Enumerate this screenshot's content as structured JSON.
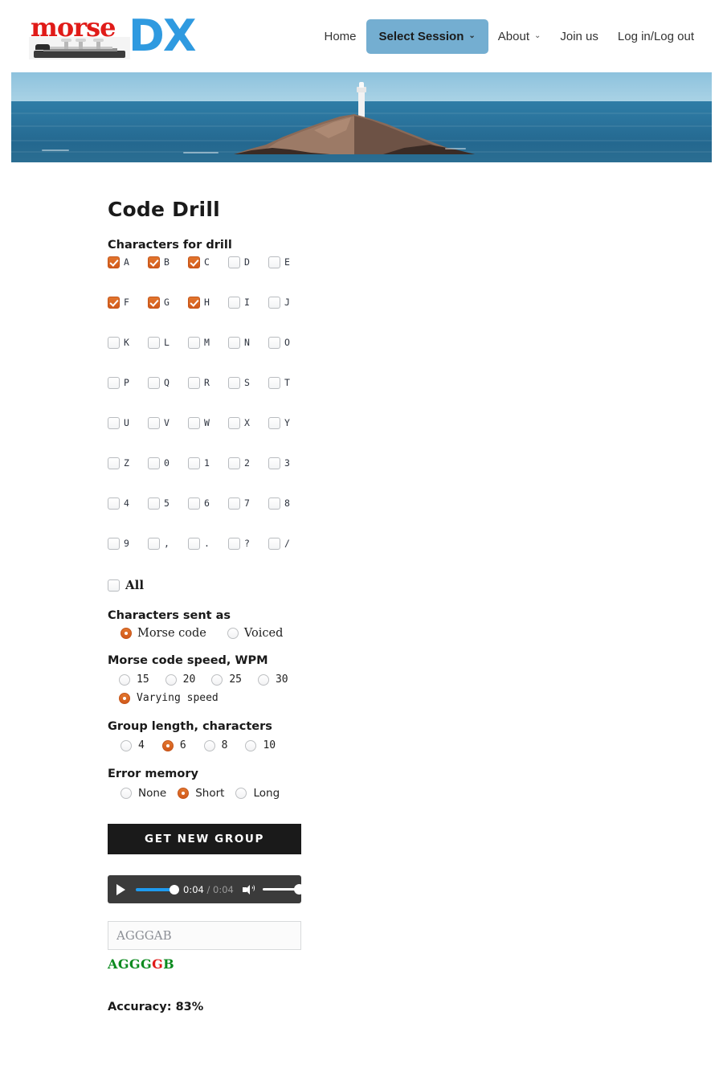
{
  "header": {
    "logo": {
      "text_primary": "morse",
      "text_secondary": "DX",
      "icon": "telegraph-key-icon"
    },
    "nav": [
      {
        "label": "Home",
        "active": false,
        "caret": ""
      },
      {
        "label": "Select Session",
        "active": true,
        "caret": "⌄"
      },
      {
        "label": "About",
        "active": false,
        "caret": "⌄"
      },
      {
        "label": "Join us",
        "active": false,
        "caret": ""
      },
      {
        "label": "Log in/Log out",
        "active": false,
        "caret": ""
      }
    ]
  },
  "hero": {
    "alt": "lighthouse-on-rock-island-photo"
  },
  "main": {
    "title": "Code Drill",
    "characters_label": "Characters for drill",
    "char_rows": [
      [
        {
          "c": "A",
          "on": true
        },
        {
          "c": "B",
          "on": true
        },
        {
          "c": "C",
          "on": true
        },
        {
          "c": "D",
          "on": false
        },
        {
          "c": "E",
          "on": false
        }
      ],
      [
        {
          "c": "F",
          "on": true
        },
        {
          "c": "G",
          "on": true
        },
        {
          "c": "H",
          "on": true
        },
        {
          "c": "I",
          "on": false
        },
        {
          "c": "J",
          "on": false
        }
      ],
      [
        {
          "c": "K",
          "on": false
        },
        {
          "c": "L",
          "on": false
        },
        {
          "c": "M",
          "on": false
        },
        {
          "c": "N",
          "on": false
        },
        {
          "c": "O",
          "on": false
        }
      ],
      [
        {
          "c": "P",
          "on": false
        },
        {
          "c": "Q",
          "on": false
        },
        {
          "c": "R",
          "on": false
        },
        {
          "c": "S",
          "on": false
        },
        {
          "c": "T",
          "on": false
        }
      ],
      [
        {
          "c": "U",
          "on": false
        },
        {
          "c": "V",
          "on": false
        },
        {
          "c": "W",
          "on": false
        },
        {
          "c": "X",
          "on": false
        },
        {
          "c": "Y",
          "on": false
        }
      ],
      [
        {
          "c": "Z",
          "on": false
        },
        {
          "c": "0",
          "on": false
        },
        {
          "c": "1",
          "on": false
        },
        {
          "c": "2",
          "on": false
        },
        {
          "c": "3",
          "on": false
        }
      ],
      [
        {
          "c": "4",
          "on": false
        },
        {
          "c": "5",
          "on": false
        },
        {
          "c": "6",
          "on": false
        },
        {
          "c": "7",
          "on": false
        },
        {
          "c": "8",
          "on": false
        }
      ],
      [
        {
          "c": "9",
          "on": false
        },
        {
          "c": ",",
          "on": false
        },
        {
          "c": ".",
          "on": false
        },
        {
          "c": "?",
          "on": false
        },
        {
          "c": "/",
          "on": false
        }
      ]
    ],
    "all": {
      "label": "All",
      "on": false
    },
    "sent_as": {
      "label": "Characters sent as",
      "options": [
        {
          "label": "Morse code",
          "on": true
        },
        {
          "label": "Voiced",
          "on": false
        }
      ]
    },
    "speed": {
      "label": "Morse code speed, WPM",
      "options": [
        {
          "label": "15",
          "on": false
        },
        {
          "label": "20",
          "on": false
        },
        {
          "label": "25",
          "on": false
        },
        {
          "label": "30",
          "on": false
        }
      ],
      "varying": {
        "label": "Varying speed",
        "on": true
      }
    },
    "group_length": {
      "label": "Group length, characters",
      "options": [
        {
          "label": "4",
          "on": false
        },
        {
          "label": "6",
          "on": true
        },
        {
          "label": "8",
          "on": false
        },
        {
          "label": "10",
          "on": false
        }
      ]
    },
    "error_memory": {
      "label": "Error memory",
      "options": [
        {
          "label": "None",
          "on": false
        },
        {
          "label": "Short",
          "on": true
        },
        {
          "label": "Long",
          "on": false
        }
      ]
    },
    "get_new_group_button": "GET NEW GROUP",
    "audio": {
      "current_time": "0:04",
      "separator": "/",
      "duration": "0:04",
      "progress_percent": 100,
      "volume_percent": 100,
      "play_icon": "play-icon",
      "volume_icon": "speaker-icon"
    },
    "answer": {
      "value": "AGGGAB",
      "placeholder": ""
    },
    "result_chars": [
      {
        "ch": "A",
        "color": "#0a8a1e"
      },
      {
        "ch": "G",
        "color": "#0a8a1e"
      },
      {
        "ch": "G",
        "color": "#0a8a1e"
      },
      {
        "ch": "G",
        "color": "#0a8a1e"
      },
      {
        "ch": "G",
        "color": "#e01b18"
      },
      {
        "ch": "B",
        "color": "#0a8a1e"
      }
    ],
    "accuracy": "Accuracy: 83%"
  },
  "colors": {
    "accent_orange": "#d2591b",
    "nav_active": "#74aed1",
    "logo_red": "#e01b18",
    "logo_blue": "#2f9ae0",
    "correct_green": "#0a8a1e",
    "error_red": "#e01b18",
    "audio_progress": "#1e9bf0"
  }
}
